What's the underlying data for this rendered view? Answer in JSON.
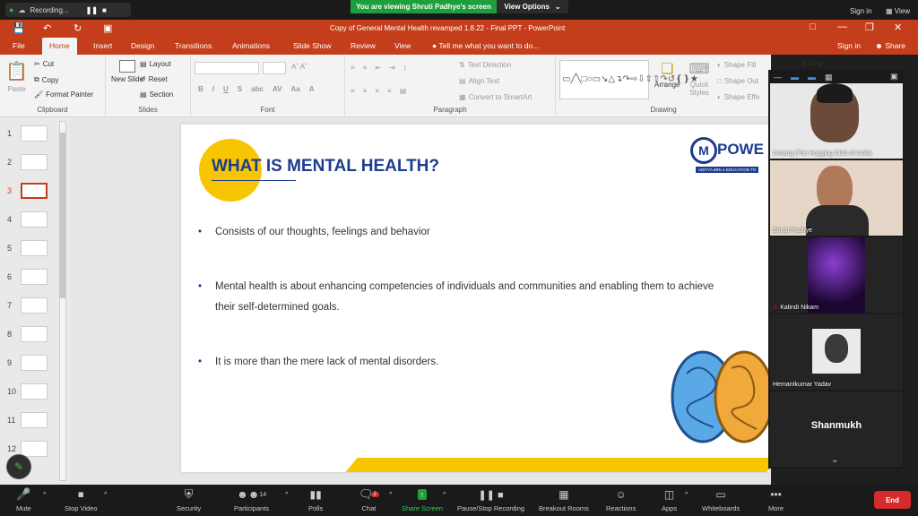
{
  "zoom": {
    "recording": "Recording...",
    "viewing_banner": "You are viewing Shruti Padhye's screen",
    "view_options": "View Options",
    "signin": "Sign in",
    "view": "View",
    "controls": {
      "mute": "Mute",
      "stop_video": "Stop Video",
      "security": "Security",
      "participants": "Participants",
      "participants_count": "14",
      "polls": "Polls",
      "chat": "Chat",
      "chat_badge": "2",
      "share_screen": "Share Screen",
      "pause_recording": "Pause/Stop Recording",
      "breakout": "Breakout Rooms",
      "reactions": "Reactions",
      "apps": "Apps",
      "whiteboards": "Whiteboards",
      "more": "More",
      "end": "End"
    },
    "participants": [
      {
        "name": "Umang (The Hugging Club of India)"
      },
      {
        "name": "Shruti Padhye"
      },
      {
        "name": "Kalindi Nikam"
      },
      {
        "name": "Hemantkumar Yadav"
      },
      {
        "name": "Shanmukh"
      }
    ],
    "accent": "#1e9e3c",
    "end_color": "#d72a2a"
  },
  "ppt": {
    "title": "Copy of General Mental Health revamped 1.8.22 - Final PPT - PowerPoint",
    "signin": "Sign in",
    "share": "Share",
    "tabs": [
      "File",
      "Home",
      "Insert",
      "Design",
      "Transitions",
      "Animations",
      "Slide Show",
      "Review",
      "View"
    ],
    "tellme": "Tell me what you want to do...",
    "ribbon": {
      "paste": "Paste",
      "cut": "Cut",
      "copy": "Copy",
      "format_painter": "Format Painter",
      "clipboard": "Clipboard",
      "new_slide": "New Slide",
      "layout": "Layout",
      "reset": "Reset",
      "section": "Section",
      "slides": "Slides",
      "font": "Font",
      "text_direction": "Text Direction",
      "align_text": "Align Text",
      "convert_smartart": "Convert to SmartArt",
      "paragraph": "Paragraph",
      "arrange": "Arrange",
      "quick_styles": "Quick Styles",
      "shape_fill": "Shape Fill",
      "shape_outline": "Shape Out",
      "shape_effects": "Shape Effe",
      "drawing": "Drawing",
      "find": "Find"
    },
    "thumbnails": [
      "1",
      "2",
      "3",
      "4",
      "5",
      "6",
      "7",
      "8",
      "9",
      "10",
      "11",
      "12"
    ],
    "selected_slide": "3",
    "brand": "#c43e1c"
  },
  "slide": {
    "title": "WHAT IS MENTAL HEALTH?",
    "logo_text": "POWE",
    "logo_tagline": "ADITYA BIRLA EDUCATION TR",
    "bullets": [
      "Consists of our thoughts, feelings and behavior",
      "Mental health is about enhancing competencies of individuals and communities and enabling them to achieve their self-determined goals.",
      "It is more than the mere lack of mental disorders."
    ],
    "title_color": "#1d3c8f",
    "circle_color": "#f7c600"
  }
}
